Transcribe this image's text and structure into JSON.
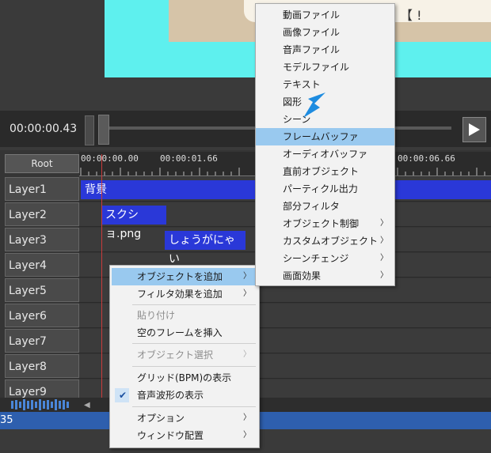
{
  "preview": {
    "overlay_text": "【 !"
  },
  "playback": {
    "timecode": "00:00:00.43"
  },
  "timeline": {
    "root_label": "Root",
    "ruler": [
      "00:00:00.00",
      "00:00:01.66",
      "00:00:06.66"
    ],
    "layers": [
      "Layer1",
      "Layer2",
      "Layer3",
      "Layer4",
      "Layer5",
      "Layer6",
      "Layer7",
      "Layer8",
      "Layer9"
    ],
    "clips": [
      {
        "layer": "Layer1",
        "text": "背景"
      },
      {
        "layer": "Layer2",
        "text": "スクショ.png"
      },
      {
        "layer": "Layer3",
        "text": "しょうがにゃい"
      }
    ]
  },
  "status": {
    "text": "35"
  },
  "context_menu": {
    "items": [
      {
        "label": "オブジェクトを追加",
        "has_submenu": true,
        "highlighted": true
      },
      {
        "label": "フィルタ効果を追加",
        "has_submenu": true
      },
      {
        "label": "貼り付け",
        "disabled": true
      },
      {
        "label": "空のフレームを挿入"
      },
      {
        "label": "オブジェクト選択",
        "disabled": true,
        "has_submenu": true
      },
      {
        "label": "グリッド(BPM)の表示"
      },
      {
        "label": "音声波形の表示",
        "checked": true
      },
      {
        "label": "オプション",
        "has_submenu": true
      },
      {
        "label": "ウィンドウ配置",
        "has_submenu": true
      }
    ]
  },
  "submenu": {
    "items": [
      {
        "label": "動画ファイル"
      },
      {
        "label": "画像ファイル"
      },
      {
        "label": "音声ファイル"
      },
      {
        "label": "モデルファイル"
      },
      {
        "label": "テキスト"
      },
      {
        "label": "図形"
      },
      {
        "label": "シーン"
      },
      {
        "label": "フレームバッファ",
        "highlighted": true
      },
      {
        "label": "オーディオバッファ"
      },
      {
        "label": "直前オブジェクト"
      },
      {
        "label": "パーティクル出力"
      },
      {
        "label": "部分フィルタ"
      },
      {
        "label": "オブジェクト制御",
        "has_submenu": true
      },
      {
        "label": "カスタムオブジェクト",
        "has_submenu": true
      },
      {
        "label": "シーンチェンジ",
        "has_submenu": true
      },
      {
        "label": "画面効果",
        "has_submenu": true
      }
    ]
  },
  "colors": {
    "clip": "#2a38d8",
    "highlight": "#99c9ef",
    "statusbar": "#2e5fae",
    "playhead": "#c83b3b",
    "pointer": "#1e8ce0"
  }
}
